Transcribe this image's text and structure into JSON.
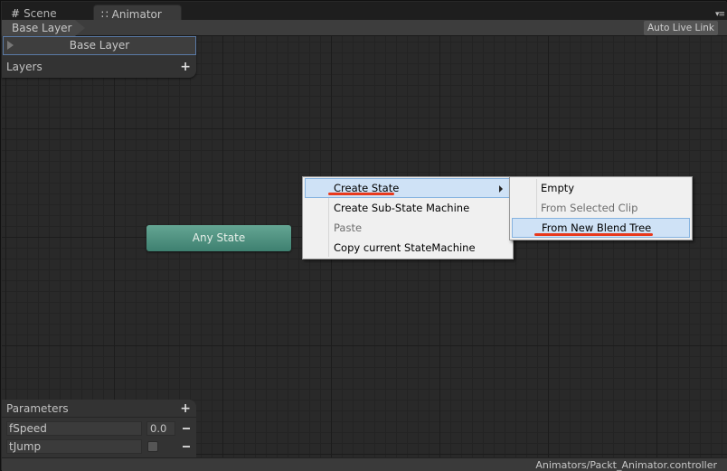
{
  "tabs": [
    {
      "label": "Scene",
      "icon": "grid-hash-icon",
      "glyph": "#",
      "active": false
    },
    {
      "label": "Animator",
      "icon": "animator-icon",
      "glyph": "∷",
      "active": true
    }
  ],
  "tab_menu_glyph": "▾≡",
  "breadcrumb": {
    "label": "Base Layer"
  },
  "toolbar": {
    "auto_live_link": "Auto Live Link"
  },
  "layers": {
    "title": "Layers",
    "add_glyph": "+",
    "items": [
      {
        "label": "Base Layer",
        "selected": true
      }
    ]
  },
  "graph": {
    "nodes": [
      {
        "label": "Any State",
        "color": "#4f927f"
      }
    ]
  },
  "context_menu": {
    "items": [
      {
        "label": "Create State",
        "enabled": true,
        "highlighted": true,
        "has_submenu": true
      },
      {
        "label": "Create Sub-State Machine",
        "enabled": true
      },
      {
        "label": "Paste",
        "enabled": false
      },
      {
        "label": "Copy current StateMachine",
        "enabled": true
      }
    ],
    "submenu": [
      {
        "label": "Empty",
        "enabled": true
      },
      {
        "label": "From Selected Clip",
        "enabled": false
      },
      {
        "label": "From New Blend Tree",
        "enabled": true,
        "highlighted": true
      }
    ],
    "annotation_color": "#e8391c"
  },
  "parameters": {
    "title": "Parameters",
    "add_glyph": "+",
    "items": [
      {
        "name": "fSpeed",
        "type": "float",
        "value": "0.0"
      },
      {
        "name": "tJump",
        "type": "trigger",
        "value": false
      }
    ]
  },
  "status": {
    "path": "Animators/Packt_Animator.controller"
  }
}
